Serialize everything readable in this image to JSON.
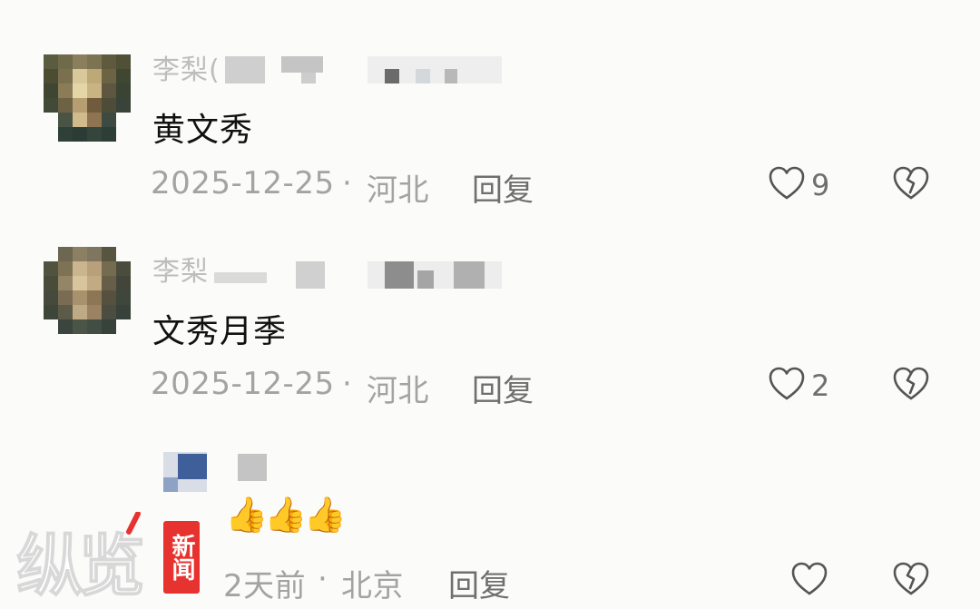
{
  "comments": [
    {
      "username": "李梨(",
      "text": "黄文秀",
      "date": "2025-12-25",
      "separator": "·",
      "location": "河北",
      "reply_label": "回复",
      "likes": "9",
      "liked": false
    },
    {
      "username": "李梨",
      "text": "文秀月季",
      "date": "2025-12-25",
      "separator": "·",
      "location": "河北",
      "reply_label": "回复",
      "likes": "2",
      "liked": false
    },
    {
      "username": "",
      "text": "👍👍👍",
      "date": "2天前",
      "separator": "·",
      "location": "北京",
      "reply_label": "回复",
      "likes": "",
      "liked": false
    }
  ],
  "watermark": {
    "brand": "纵览",
    "badge": "新闻",
    "accent": "#e7332f"
  },
  "icons": {
    "like": "heart-outline-icon",
    "dislike": "broken-heart-icon"
  }
}
